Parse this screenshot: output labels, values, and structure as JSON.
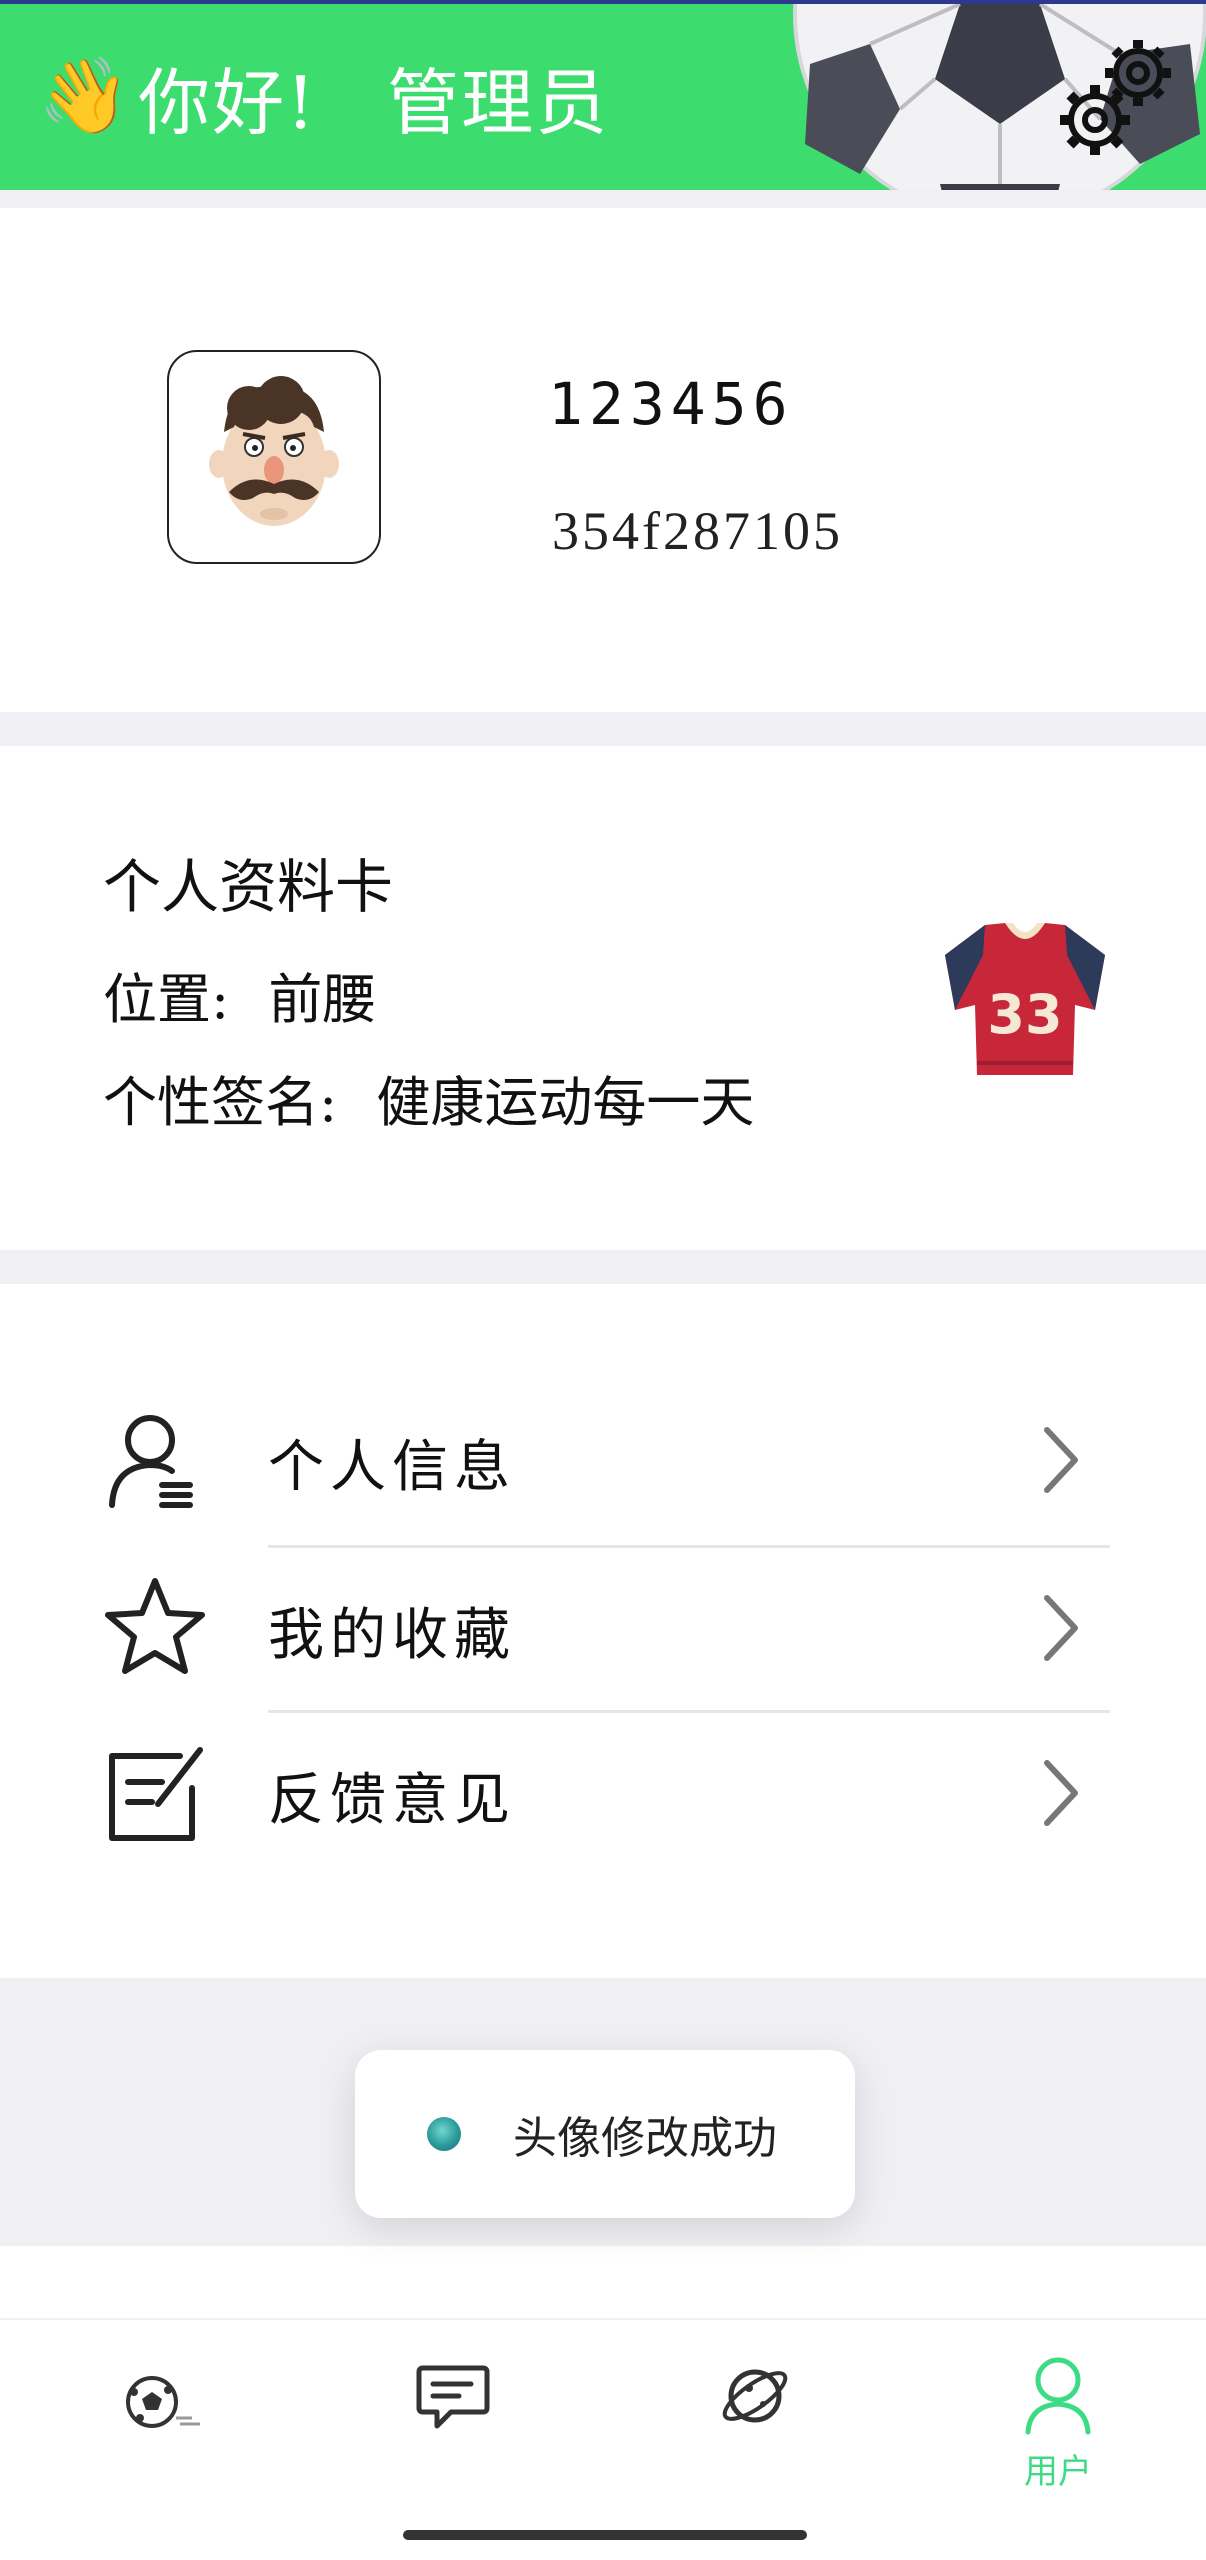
{
  "header": {
    "wave_emoji": "👋",
    "greeting": "你好!",
    "role": "管理员",
    "bg_color": "#3ddc6e"
  },
  "profile": {
    "name": "123456",
    "user_id": "354f287105"
  },
  "card": {
    "title": "个人资料卡",
    "position_label": "位置:",
    "position_value": "前腰",
    "signature_label": "个性签名:",
    "signature_value": "健康运动每一天"
  },
  "menu": {
    "items": [
      {
        "label": "个人信息",
        "icon": "user-profile-icon"
      },
      {
        "label": "我的收藏",
        "icon": "star-icon"
      },
      {
        "label": "反馈意见",
        "icon": "edit-note-icon"
      }
    ]
  },
  "toast": {
    "message": "头像修改成功"
  },
  "tabbar": {
    "tabs": [
      {
        "icon": "soccer-ball-icon",
        "label": ""
      },
      {
        "icon": "chat-icon",
        "label": ""
      },
      {
        "icon": "planet-icon",
        "label": ""
      },
      {
        "icon": "user-icon",
        "label": "用户",
        "active": true
      }
    ],
    "active_color": "#3ddc84"
  }
}
